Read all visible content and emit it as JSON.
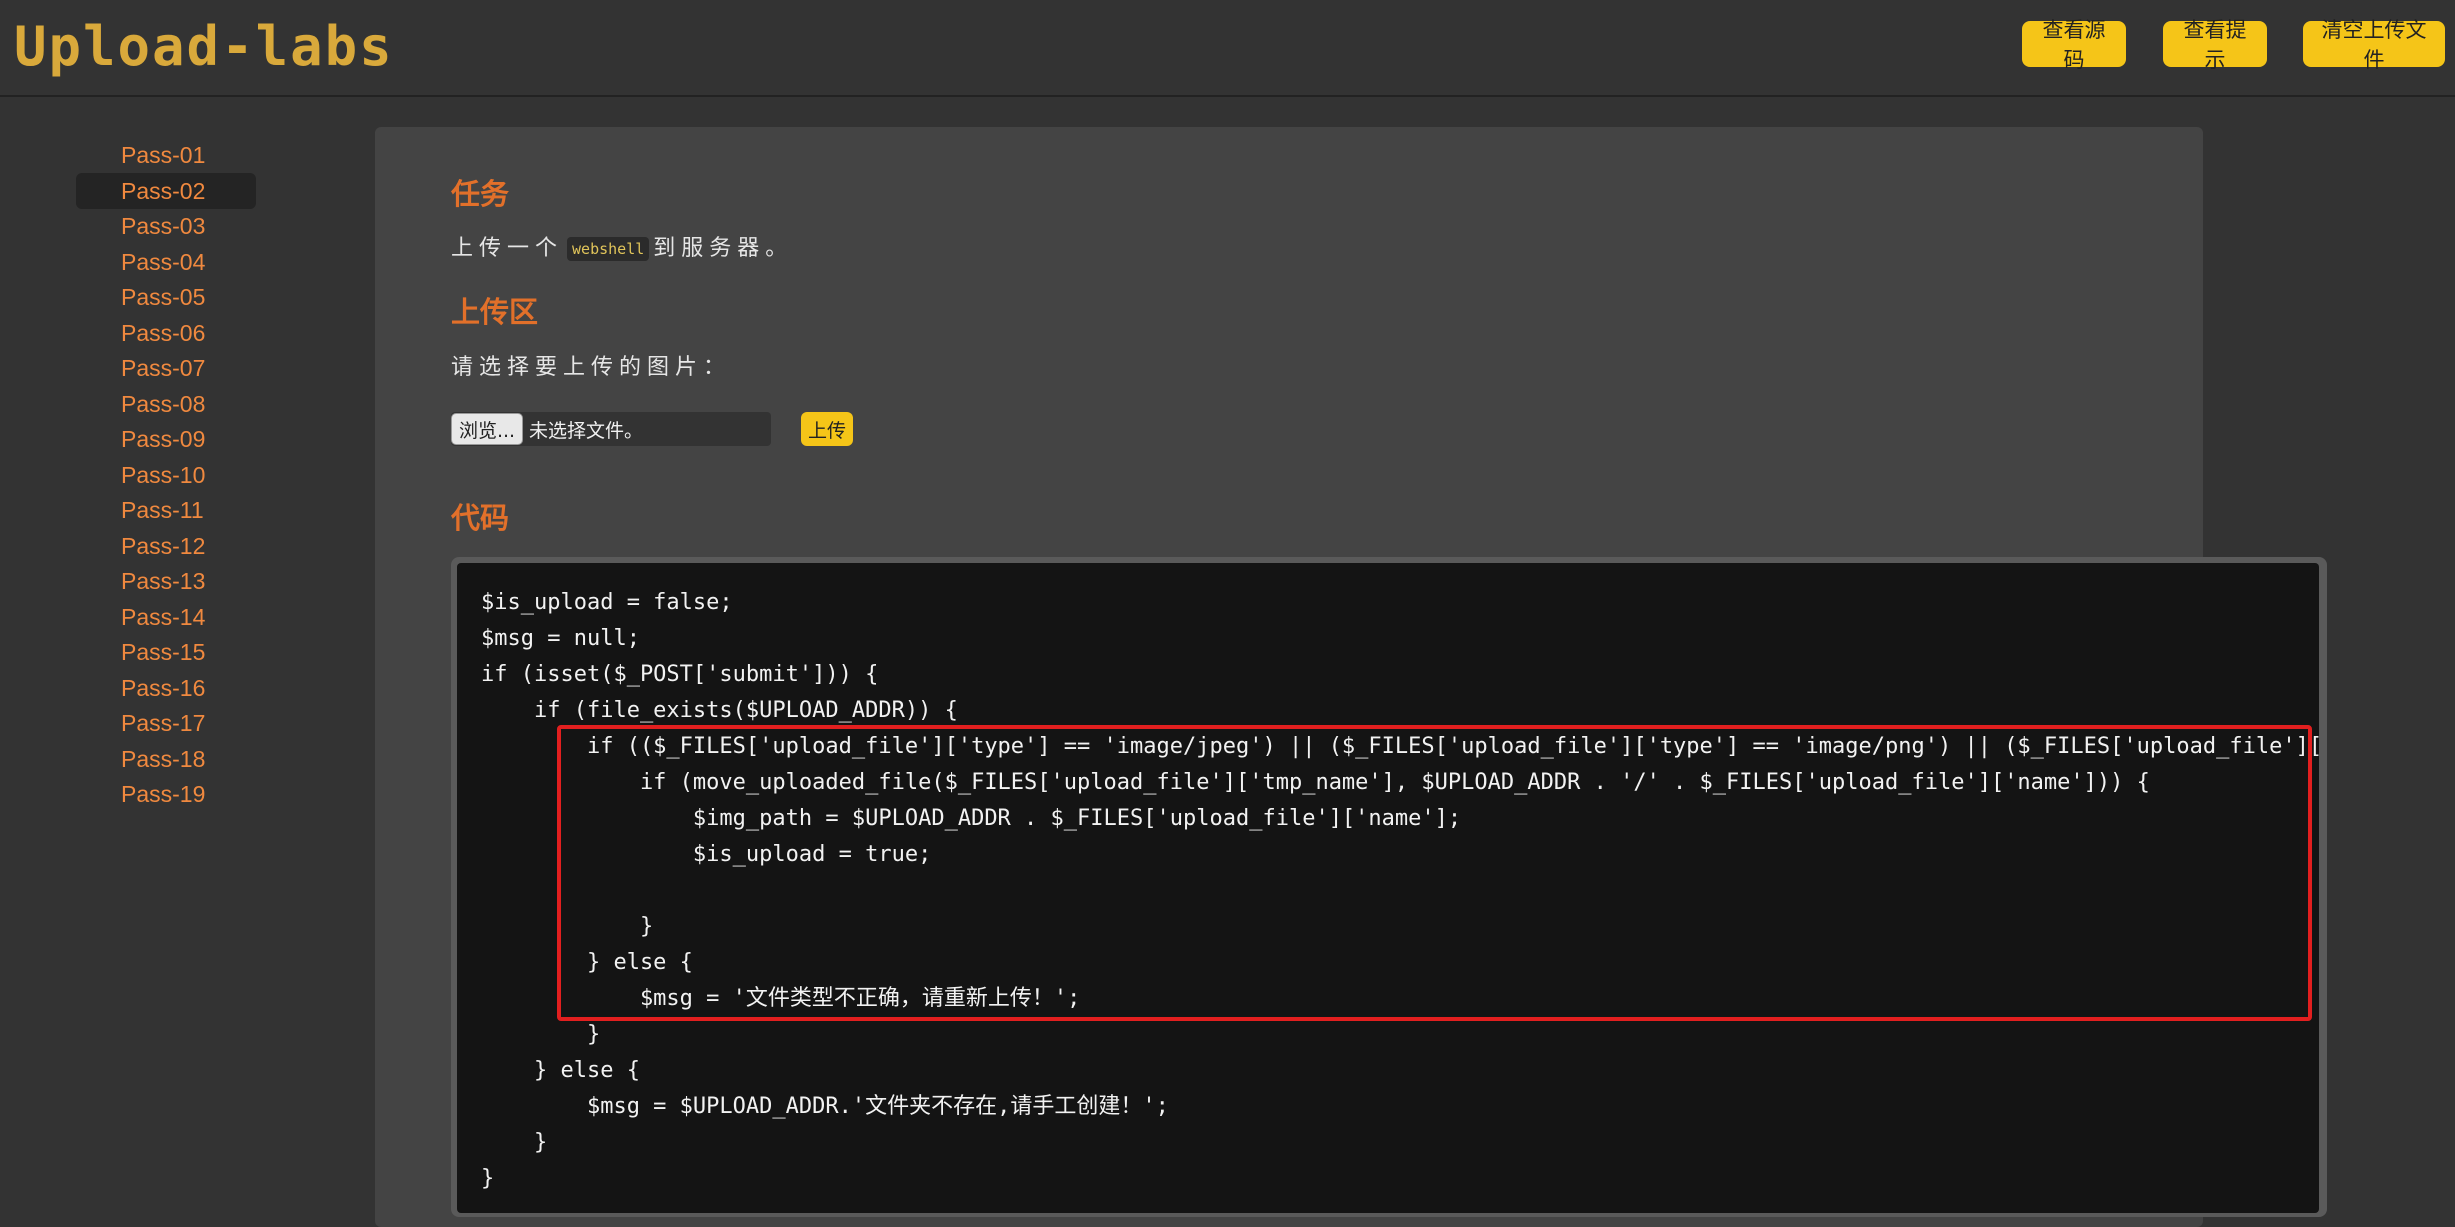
{
  "header": {
    "logo_text": "Upload-labs",
    "buttons": [
      "查看源码",
      "查看提示",
      "清空上传文件"
    ]
  },
  "sidebar": {
    "items": [
      "Pass-01",
      "Pass-02",
      "Pass-03",
      "Pass-04",
      "Pass-05",
      "Pass-06",
      "Pass-07",
      "Pass-08",
      "Pass-09",
      "Pass-10",
      "Pass-11",
      "Pass-12",
      "Pass-13",
      "Pass-14",
      "Pass-15",
      "Pass-16",
      "Pass-17",
      "Pass-18",
      "Pass-19"
    ],
    "active_index": 1
  },
  "task": {
    "title": "任务",
    "text_before": "上传一个",
    "code": "webshell",
    "text_after": "到服务器。"
  },
  "upload": {
    "title": "上传区",
    "prompt": "请选择要上传的图片：",
    "browse_label": "浏览...",
    "file_status": "未选择文件。",
    "submit_label": "上传"
  },
  "code_section": {
    "title": "代码",
    "lines": [
      "$is_upload = false;",
      "$msg = null;",
      "if (isset($_POST['submit'])) {",
      "    if (file_exists($UPLOAD_ADDR)) {",
      "        if (($_FILES['upload_file']['type'] == 'image/jpeg') || ($_FILES['upload_file']['type'] == 'image/png') || ($_FILES['upload_file'][",
      "            if (move_uploaded_file($_FILES['upload_file']['tmp_name'], $UPLOAD_ADDR . '/' . $_FILES['upload_file']['name'])) {",
      "                $img_path = $UPLOAD_ADDR . $_FILES['upload_file']['name'];",
      "                $is_upload = true;",
      "",
      "            }",
      "        } else {",
      "            $msg = '文件类型不正确，请重新上传！';",
      "        }",
      "    } else {",
      "        $msg = $UPLOAD_ADDR.'文件夹不存在,请手工创建！';",
      "    }",
      "}"
    ]
  },
  "colors": {
    "accent": "#f5c518",
    "link": "#f0893f",
    "heading": "#e2702a",
    "highlight": "#e21f1f"
  }
}
